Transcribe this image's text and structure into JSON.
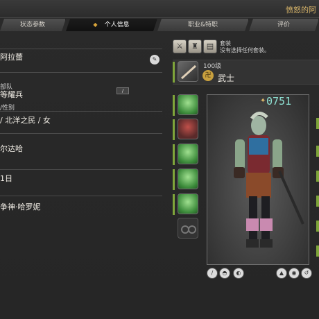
{
  "window": {
    "title": "愤怒的阿"
  },
  "tabs": [
    {
      "label": "状态参数"
    },
    {
      "label": "个人信息"
    },
    {
      "label": "职业&特职"
    },
    {
      "label": "评价"
    }
  ],
  "profile": {
    "name": "阿拉蕾",
    "company_label": "部队",
    "company_value": "等耀兵",
    "race_label": "/性别",
    "race_value": "/ 北洋之民 / 女",
    "guardian_value": "尔达哈",
    "nameday_value": "1日",
    "deity_value": "争神·哈罗妮"
  },
  "gearset": {
    "label_line1": "套装",
    "label_line2": "没有选择任何套装。"
  },
  "job": {
    "level": "100级",
    "name": "武士"
  },
  "item_level": "0751",
  "colors": {
    "accent": "#d9b66a",
    "slot_green": "#3b8a3a",
    "bar_green": "#7fa53a",
    "ilvl": "#8ee0d2"
  }
}
